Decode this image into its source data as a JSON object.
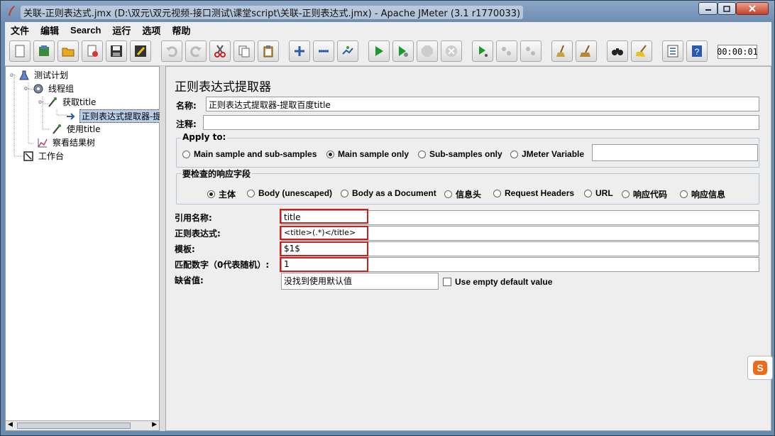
{
  "window": {
    "title": "关联-正则表达式.jmx (D:\\双元\\双元视频-接口测试\\课堂script\\关联-正则表达式.jmx) - Apache JMeter (3.1 r1770033)"
  },
  "menubar": {
    "items": [
      "文件",
      "编辑",
      "Search",
      "运行",
      "选项",
      "帮助"
    ]
  },
  "toolbar": {
    "timer": "00:00:01"
  },
  "tree": {
    "nodes": [
      {
        "label": "测试计划"
      },
      {
        "label": "线程组"
      },
      {
        "label": "获取title"
      },
      {
        "label": "正则表达式提取器-提"
      },
      {
        "label": "使用title"
      },
      {
        "label": "察看结果树"
      },
      {
        "label": "工作台"
      }
    ]
  },
  "panel": {
    "title": "正则表达式提取器",
    "name_label": "名称:",
    "name_value": "正则表达式提取器-提取百度title",
    "comment_label": "注释:",
    "comment_value": "",
    "apply_to": {
      "title": "Apply to:",
      "options": [
        "Main sample and sub-samples",
        "Main sample only",
        "Sub-samples only",
        "JMeter Variable"
      ],
      "selected": "Main sample only",
      "variable_value": ""
    },
    "response_field": {
      "title": "要检查的响应字段",
      "options": [
        "主体",
        "Body (unescaped)",
        "Body as a Document",
        "信息头",
        "Request Headers",
        "URL",
        "响应代码",
        "响应信息"
      ],
      "selected": "主体"
    },
    "ref_name_label": "引用名称:",
    "ref_name_value": "title",
    "regex_label": "正则表达式:",
    "regex_value": "<title>(.*)</title>",
    "template_label": "模板:",
    "template_value": "$1$",
    "match_no_label": "匹配数字（0代表随机）:",
    "match_no_value": "1",
    "default_label": "缺省值:",
    "default_value": "没找到使用默认值",
    "use_empty_label": "Use empty default value"
  },
  "colors": {
    "highlight": "#cc1f1f",
    "selection": "#b8cfe5",
    "panel_bg": "#eeeeee"
  }
}
